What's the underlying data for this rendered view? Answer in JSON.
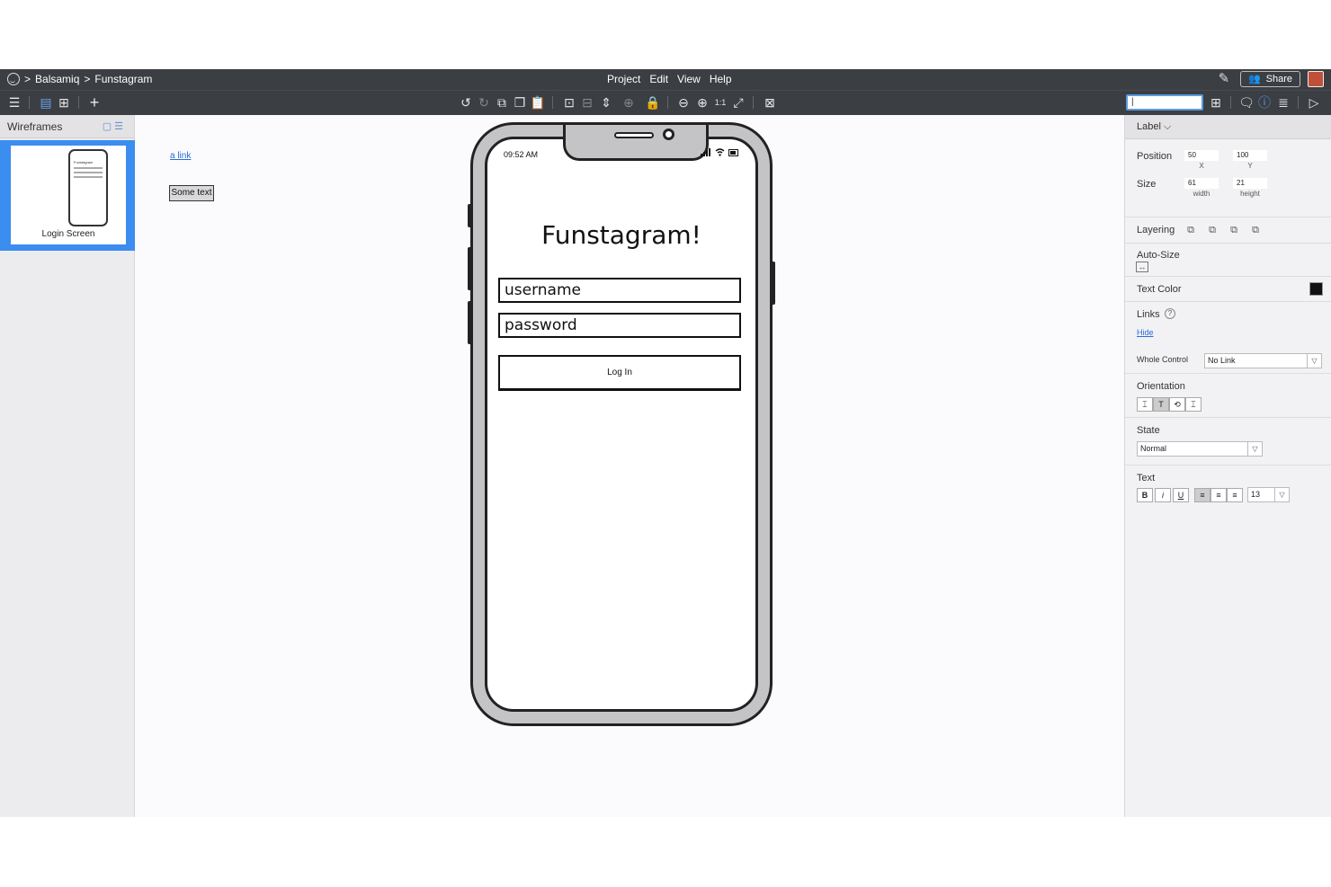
{
  "breadcrumb": {
    "sep": ">",
    "project": "Balsamiq",
    "file": "Funstagram"
  },
  "menu": [
    "Project",
    "Edit",
    "View",
    "Help"
  ],
  "share_label": "Share",
  "search": {
    "value": "|"
  },
  "toolbar_icons": [
    "hamburger-icon",
    "single-view-icon",
    "grid-view-icon",
    "add-icon",
    "undo-icon",
    "redo-icon",
    "duplicate-icon",
    "copy-icon",
    "paste-icon",
    "group-icon",
    "ungroup-icon",
    "align-icon",
    "distribute-icon",
    "lock-icon",
    "zoom-out-icon",
    "zoom-in-icon",
    "actual-size-icon",
    "fit-icon",
    "delete-icon"
  ],
  "left_panel": {
    "title": "Wireframes",
    "thumbnail": {
      "label": "Login Screen",
      "mini_title": "Funstagram"
    }
  },
  "canvas": {
    "link_text": "a link",
    "label_text": "Some text"
  },
  "phone": {
    "time": "09:52 AM",
    "title": "Funstagram!",
    "username_value": "username",
    "password_value": "password",
    "login_label": "Log In"
  },
  "inspector": {
    "type": "Label",
    "position_label": "Position",
    "x": "50",
    "x_label": "X",
    "y": "100",
    "y_label": "Y",
    "size_label": "Size",
    "width": "61",
    "width_label": "width",
    "height": "21",
    "height_label": "height",
    "layering_label": "Layering",
    "autosize_label": "Auto-Size",
    "text_color_label": "Text Color",
    "text_color": "#111111",
    "links_label": "Links",
    "links_help": "?",
    "hide_label": "Hide",
    "whole_control_label": "Whole Control",
    "whole_control_value": "No Link",
    "orientation_label": "Orientation",
    "state_label": "State",
    "state_value": "Normal",
    "text_label": "Text",
    "bold": "B",
    "italic": "i",
    "underline": "U",
    "font_size": "13"
  }
}
